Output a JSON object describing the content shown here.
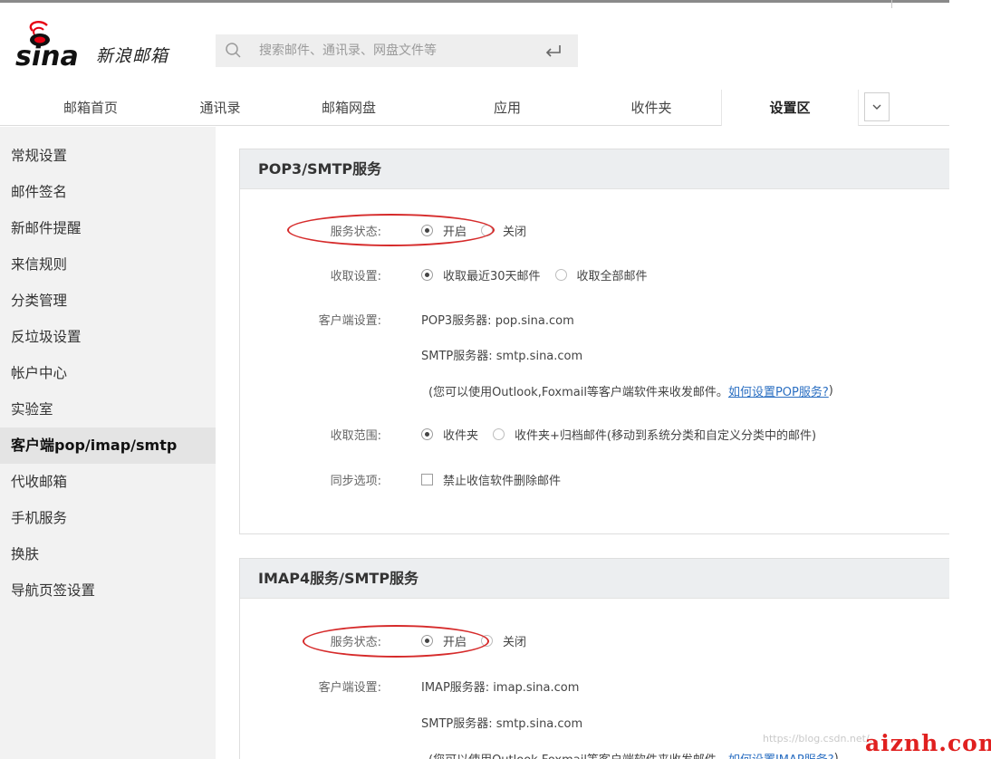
{
  "brand": {
    "logo_text": "新浪邮箱"
  },
  "search": {
    "placeholder": "搜索邮件、通讯录、网盘文件等"
  },
  "nav": {
    "tabs": [
      "邮箱首页",
      "通讯录",
      "邮箱网盘",
      "应用",
      "收件夹",
      "设置区"
    ],
    "active": "设置区"
  },
  "sidebar": {
    "items": [
      "常规设置",
      "邮件签名",
      "新邮件提醒",
      "来信规则",
      "分类管理",
      "反垃圾设置",
      "帐户中心",
      "实验室",
      "客户端pop/imap/smtp",
      "代收邮箱",
      "手机服务",
      "换肤",
      "导航页签设置"
    ],
    "active": "客户端pop/imap/smtp"
  },
  "pop": {
    "title": "POP3/SMTP服务",
    "status_label": "服务状态:",
    "status_on": "开启",
    "status_off": "关闭",
    "fetch_label": "收取设置:",
    "fetch_opt1": "收取最近30天邮件",
    "fetch_opt2": "收取全部邮件",
    "client_label": "客户端设置:",
    "pop_server": "POP3服务器: pop.sina.com",
    "smtp_server": "SMTP服务器: smtp.sina.com",
    "note": "(您可以使用Outlook,Foxmail等客户端软件来收发邮件。",
    "note_link": "如何设置POP服务?",
    "note_end": ")",
    "range_label": "收取范围:",
    "range_opt1": "收件夹",
    "range_opt2": "收件夹+归档邮件(移动到系统分类和自定义分类中的邮件)",
    "sync_label": "同步选项:",
    "sync_opt": "禁止收信软件删除邮件"
  },
  "imap": {
    "title": "IMAP4服务/SMTP服务",
    "status_label": "服务状态:",
    "status_on": "开启",
    "status_off": "关闭",
    "client_label": "客户端设置:",
    "imap_server": "IMAP服务器: imap.sina.com",
    "smtp_server": "SMTP服务器: smtp.sina.com",
    "note": "(您可以使用Outlook,Foxmail等客户端软件来收发邮件。",
    "note_link": "如何设置IMAP服务?",
    "note_end": ")"
  },
  "watermark": {
    "small": "https://blog.csdn.net/...",
    "large": "aiznh.com"
  },
  "colors": {
    "annotation": "#d62b2b",
    "link": "#2b6fc2",
    "brand": "#e60012"
  }
}
